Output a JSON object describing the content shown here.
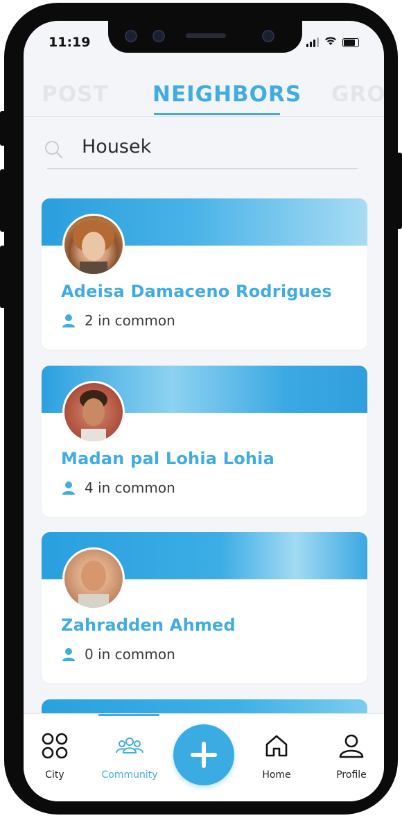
{
  "status": {
    "time": "11:19"
  },
  "tabs": [
    {
      "label": "POST",
      "active": false
    },
    {
      "label": "NEIGHBORS",
      "active": true
    },
    {
      "label": "GROU",
      "active": false
    }
  ],
  "search": {
    "value": "Housek",
    "icon": "search-icon"
  },
  "neighbors": [
    {
      "name": "Adeisa Damaceno Rodrigues",
      "common": "2 in common"
    },
    {
      "name": "Madan pal Lohia Lohia",
      "common": "4 in common"
    },
    {
      "name": "Zahradden Ahmed",
      "common": "0 in common"
    }
  ],
  "nav": {
    "city": "City",
    "community": "Community",
    "home": "Home",
    "profile": "Profile"
  },
  "colors": {
    "accent": "#41ace2",
    "inactive_tab": "#e2e6ea",
    "background": "#f3f5f8"
  }
}
